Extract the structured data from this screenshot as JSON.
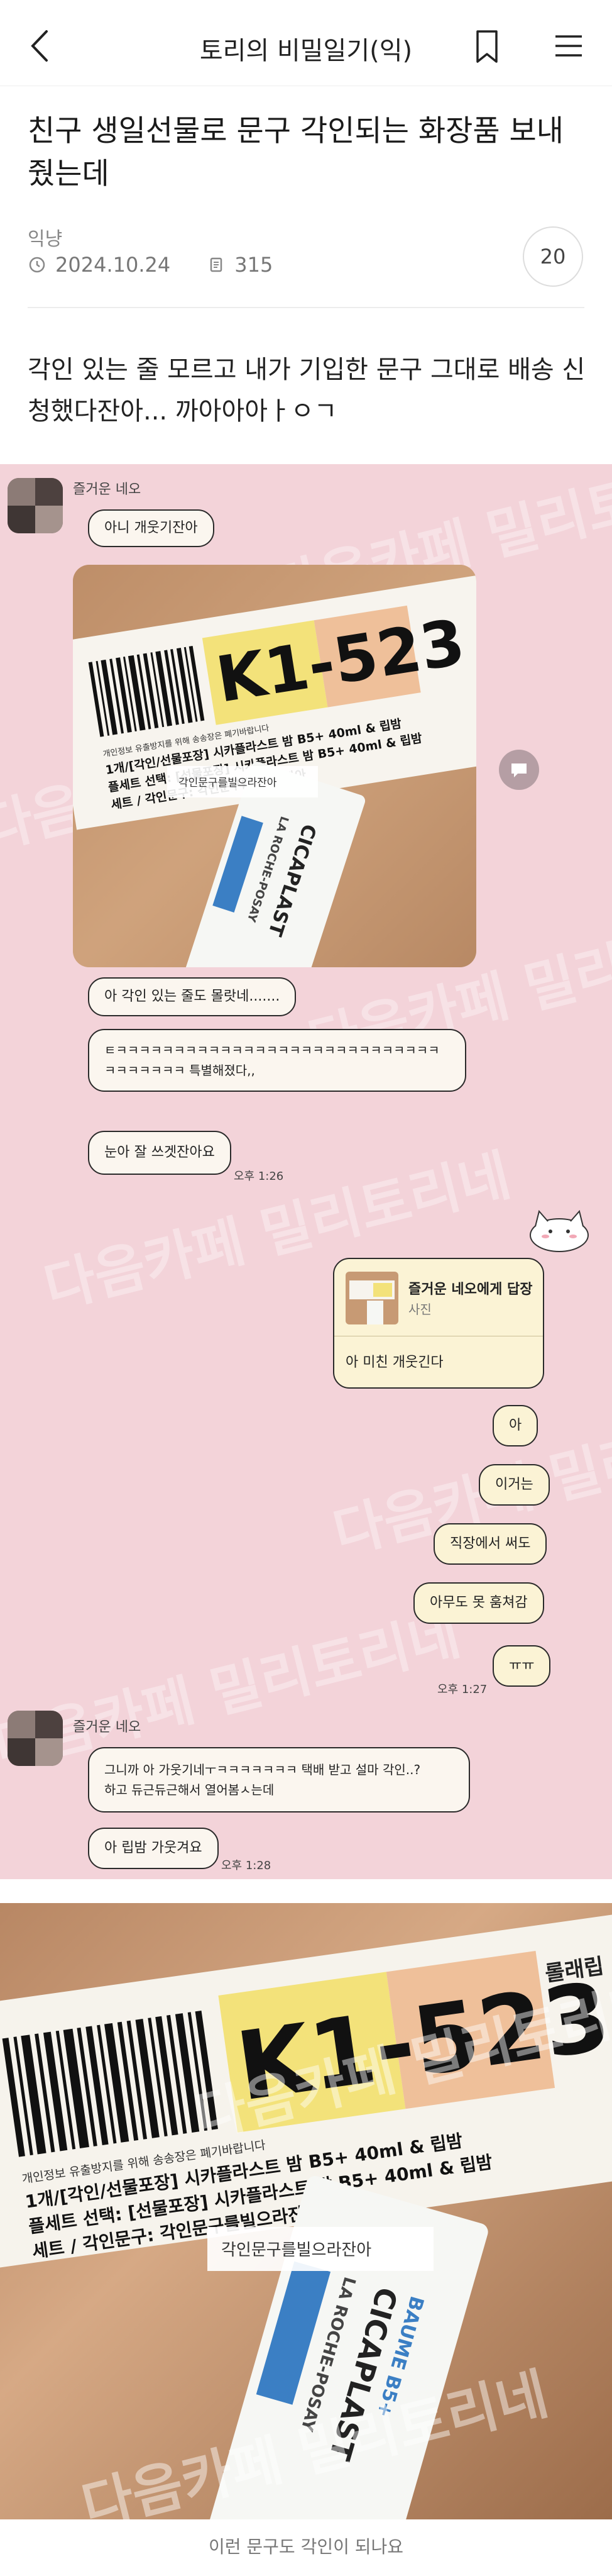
{
  "header": {
    "title": "토리의 비밀일기(익)"
  },
  "post": {
    "title": "친구 생일선물로 문구 각인되는 화장품 보내줬는데",
    "author": "익냥",
    "date": "2024.10.24",
    "views": "315",
    "comment_count": "20",
    "body": "각인 있는 줄 모르고 내가 기입한 문구 그대로 배송 신청했다잔아... 까아아아ㅏㅇㄱ"
  },
  "watermark": "다음카페 밀리토리네",
  "chat": {
    "friend_name": "즐거운 네오",
    "reply_header": "즐거운 네오에게 답장",
    "reply_sub": "사진",
    "messages_friend_1": [
      "아니 개웃기잔아"
    ],
    "messages_friend_2": [
      "아 각인 있는 줄도 몰랏네.......",
      "ㅌㅋㅋㅋㅋㅋㅋㅋㅋㅋㅋㅋㅋㅋㅋㅋㅋㅋㅋㅋㅋㅋㅋㅋㅋㅋㅋㅋㅋ\nㅋㅋㅋㅋㅋㅋㅋ 특별해졌다,,",
      "눈아 잘 쓰겟잔아요"
    ],
    "time_1": "오후 1:26",
    "my_reply_text": "아 미친 개웃긴다",
    "my_messages": [
      "아",
      "이거는",
      "직장에서 써도",
      "아무도 못 훔쳐감",
      "ㅠㅠ"
    ],
    "time_2": "오후 1:27",
    "friend_2_messages": [
      "그니까 아 가웃기네ㅜㅋㅋㅋㅋㅋㅋㅋ 택배 받고 설마 각인..?\n하고 듀근듀근해서 열어봄ㅅ는데",
      "아 립밤 가웃겨요"
    ],
    "time_3": "오후 1:28"
  },
  "product_label": {
    "code": "K1-523",
    "line1": "개인정보 유출방지를 위해 송송장은 폐기바랍니다",
    "line2": "1개/[각인/선물포장] 시카플라스트 밤 B5+ 40ml & 립밤",
    "line3": "플세트 선택: [선물포장] 시카플라스트 밤 B5+ 40ml & 립밤",
    "line4": "세트 / 각인문구: 각인문구를빌으라잔아",
    "side_text": "롤래립",
    "tube_brand": "LA ROCHE-POSAY",
    "tube_name": "CICAPLAST",
    "tube_sub": "BAUME B5+",
    "tube_engraving": "각인문구를빌으라잔아"
  },
  "caption": "이런 문구도 각인이 되나요",
  "colors": {
    "chat_bg": "#f3d3d9",
    "bubble_bg": "#fbf6ef",
    "my_bubble_bg": "#fbf3d5",
    "label_yellow": "#f3e27a",
    "label_peach": "#efc09a"
  }
}
